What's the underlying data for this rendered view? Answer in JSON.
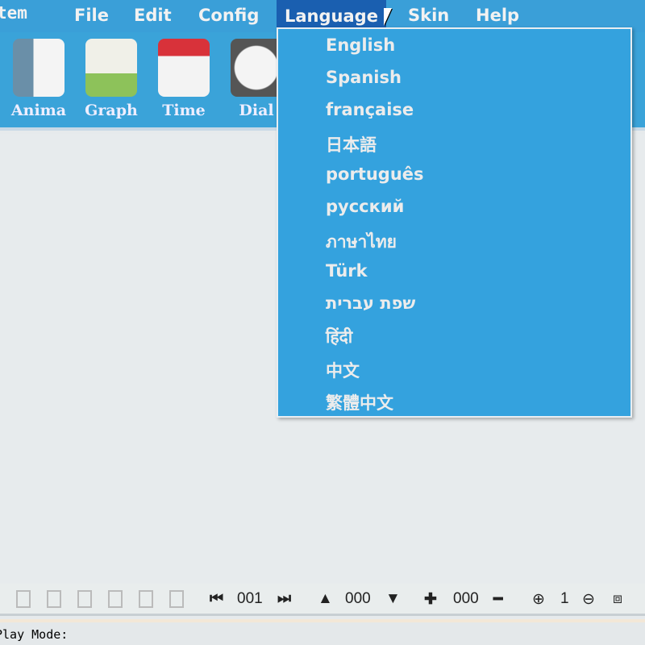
{
  "menubar": {
    "app_name": "tem",
    "items": [
      "File",
      "Edit",
      "Config",
      "Language",
      "Skin",
      "Help"
    ]
  },
  "toolbar": {
    "tools": [
      "Anima",
      "Graph",
      "Time",
      "Dial"
    ]
  },
  "language_menu": {
    "items": [
      "English",
      "Spanish",
      "française",
      "日本語",
      "português",
      "русский",
      "ภาษาไทย",
      "Türk",
      "שפת עברית",
      "हिंदी",
      "中文",
      "繁體中文"
    ]
  },
  "bottombar": {
    "frame": "001",
    "level": "000",
    "count": "000",
    "zoom": "1"
  },
  "status": {
    "play_mode_label": "Play Mode:"
  }
}
